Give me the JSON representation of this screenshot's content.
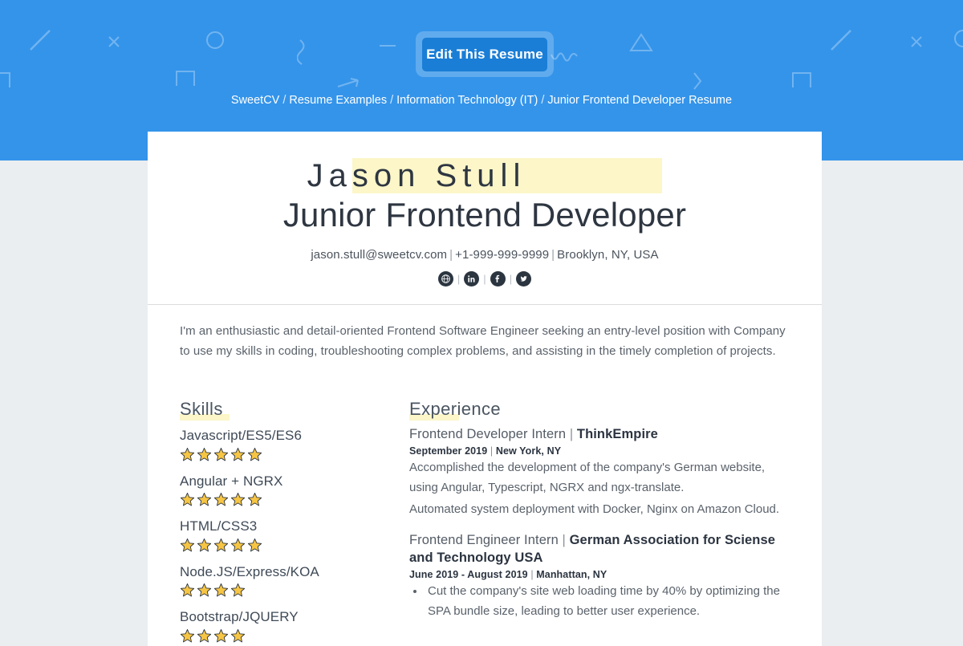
{
  "hero": {
    "background_color": "#3494ea",
    "edit_button_label": "Edit This Resume",
    "edit_button_color": "#1a7ed6",
    "decorations": [
      "slash-shape",
      "x-shape",
      "circle-shape",
      "bracket-shape",
      "squiggle-shape",
      "dash-shape",
      "arrow-shape",
      "triangle-shape",
      "chevron-shape",
      "wave-shape"
    ]
  },
  "breadcrumb": {
    "separator": "/",
    "items": [
      {
        "label": "SweetCV"
      },
      {
        "label": "Resume Examples"
      },
      {
        "label": "Information Technology (IT)"
      },
      {
        "label": "Junior Frontend Developer Resume"
      }
    ]
  },
  "resume": {
    "name_plain": "Ja",
    "name_highlighted": "son Stull",
    "full_name": "Jason Stull",
    "job_title": "Junior Frontend Developer",
    "highlight_color": "#fcf6c8",
    "contact": {
      "email": "jason.stull@sweetcv.com",
      "phone": "+1-999-999-9999",
      "location": "Brooklyn, NY, USA",
      "separator": "|"
    },
    "socials": [
      {
        "name": "website-icon",
        "label": "Website"
      },
      {
        "name": "linkedin-icon",
        "label": "LinkedIn"
      },
      {
        "name": "facebook-icon",
        "label": "Facebook"
      },
      {
        "name": "twitter-icon",
        "label": "Twitter"
      }
    ],
    "summary": "I'm an enthusiastic and detail-oriented Frontend Software Engineer seeking an entry-level position with Company to use my skills in coding, troubleshooting complex problems, and assisting in the timely completion of projects.",
    "skills_section": {
      "title": "Skills",
      "star_color": "#f6c544",
      "max_stars": 5,
      "items": [
        {
          "name": "Javascript/ES5/ES6",
          "rating": 5
        },
        {
          "name": "Angular + NGRX",
          "rating": 5
        },
        {
          "name": "HTML/CSS3",
          "rating": 5
        },
        {
          "name": "Node.JS/Express/KOA",
          "rating": 4
        },
        {
          "name": "Bootstrap/JQUERY",
          "rating": 4
        }
      ]
    },
    "experience_section": {
      "title": "Experience",
      "items": [
        {
          "role": "Frontend Developer Intern",
          "separator": "|",
          "company": "ThinkEmpire",
          "dates": "September 2019",
          "location": "New York, NY",
          "description_lines": [
            "Accomplished the development of the company's German website, using Angular, Typescript, NGRX and ngx-translate.",
            "Automated system deployment with Docker, Nginx on Amazon Cloud."
          ],
          "bullets": []
        },
        {
          "role": "Frontend Engineer Intern",
          "separator": "|",
          "company": "German Association for Sciense and Technology USA",
          "dates": "June 2019 - August 2019",
          "location": "Manhattan, NY",
          "description_lines": [],
          "bullets": [
            "Cut the company's site web loading time by 40% by optimizing the SPA bundle size, leading to better user experience."
          ]
        }
      ]
    }
  }
}
